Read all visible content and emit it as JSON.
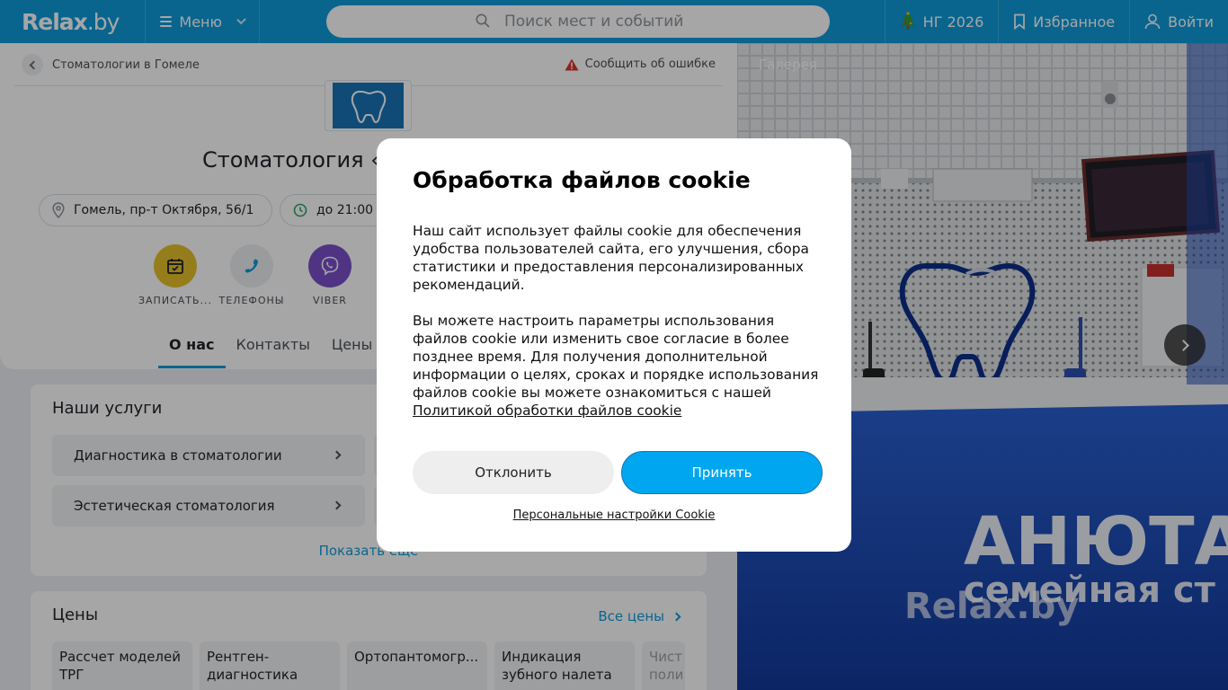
{
  "header": {
    "logo_main": "Relax",
    "logo_suffix": ".by",
    "menu_label": "Меню",
    "search_placeholder": "Поиск мест и событий",
    "ny_label": "НГ 2026",
    "favorites_label": "Избранное",
    "login_label": "Войти"
  },
  "breadcrumb": {
    "back_label": "Стоматологии в Гомеле",
    "report_label": "Сообщить об ошибке"
  },
  "place": {
    "title": "Стоматология «",
    "address": "Гомель, пр-т Октября, 56/1",
    "hours": "до 21:00"
  },
  "actions": [
    {
      "label": "ЗАПИСАТЬ...",
      "color": "#e6c02c",
      "icon": "calendar-icon"
    },
    {
      "label": "ТЕЛЕФОНЫ",
      "color": "#eceef1",
      "icon": "phone-icon"
    },
    {
      "label": "VIBER",
      "color": "#7b51c9",
      "icon": "viber-icon"
    }
  ],
  "tabs": [
    {
      "label": "О нас",
      "active": true
    },
    {
      "label": "Контакты",
      "active": false
    },
    {
      "label": "Цены",
      "active": false
    }
  ],
  "services": {
    "title": "Наши услуги",
    "items": [
      "Диагностика в стоматологии",
      "Эстетическая стоматология"
    ],
    "show_more": "Показать еще"
  },
  "prices": {
    "title": "Цены",
    "all_label": "Все цены",
    "items": [
      "Рассчет моделей ТРГ",
      "Рентген-диагностика",
      "Ортопантомогр...",
      "Индикация зубного налета",
      "Чист поли"
    ]
  },
  "gallery": {
    "title": "Галерея",
    "sign_line1": "АНЮТА",
    "sign_line2": "семейная ст",
    "watermark": "Relax.by"
  },
  "cookie": {
    "title": "Обработка файлов cookie",
    "paragraph1": "Наш сайт использует файлы cookie для обеспечения удобства пользователей сайта, его улучшения, сбора статистики и предоставления персонализированных рекомендаций.",
    "paragraph2": "Вы можете настроить параметры использования файлов cookie или изменить свое согласие в более позднее время. Для получения дополнительной информации о целях, сроках и порядке использования файлов cookie вы можете ознакомиться с нашей",
    "policy_link": "Политикой обработки файлов cookie",
    "decline_label": "Отклонить",
    "accept_label": "Принять",
    "personal_label": "Персональные настройки Cookie"
  },
  "colors": {
    "brand": "#0f9cdb",
    "accept": "#00a7f0",
    "warning": "#d9352b"
  }
}
